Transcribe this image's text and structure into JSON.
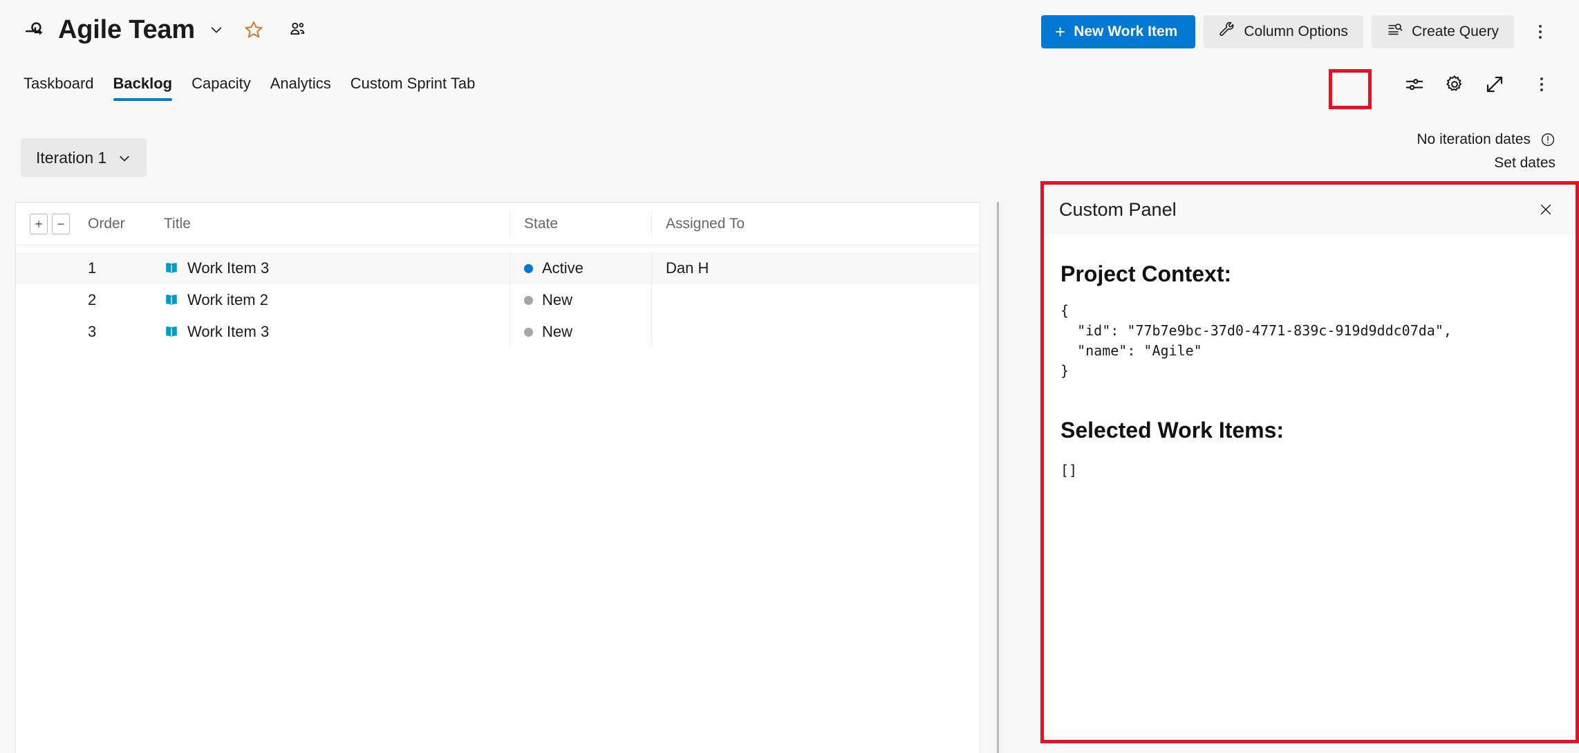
{
  "header": {
    "sprint_icon": "sprint-icon",
    "team_title": "Agile Team",
    "title_chevron_icon": "chevron-down-icon",
    "favorite_icon": "star-icon",
    "team_members_icon": "people-icon",
    "overflow_icon": "kebab-menu-icon"
  },
  "commandbar": {
    "new_work_item_label": "New Work Item",
    "new_work_item_plus": "+",
    "column_options_label": "Column Options",
    "column_options_icon": "wrench-icon",
    "create_query_label": "Create Query",
    "create_query_icon": "query-list-search-icon"
  },
  "tabs": [
    {
      "label": "Taskboard",
      "active": false
    },
    {
      "label": "Backlog",
      "active": true
    },
    {
      "label": "Capacity",
      "active": false
    },
    {
      "label": "Analytics",
      "active": false
    },
    {
      "label": "Custom Sprint Tab",
      "active": false
    }
  ],
  "tool_icons": [
    {
      "name": "view-options-sliders-icon",
      "highlighted": true
    },
    {
      "name": "gear-settings-icon",
      "highlighted": false
    },
    {
      "name": "full-screen-expand-icon",
      "highlighted": false
    },
    {
      "name": "kebab-menu-icon",
      "highlighted": false
    }
  ],
  "iteration": {
    "selected": "Iteration 1",
    "chevron_icon": "chevron-down-icon"
  },
  "iteration_dates": {
    "status": "No iteration dates",
    "info_icon": "warning-circle-icon",
    "action": "Set dates"
  },
  "grid": {
    "expand_all_label": "+",
    "collapse_all_label": "−",
    "columns": [
      "Order",
      "Title",
      "State",
      "Assigned To"
    ],
    "rows": [
      {
        "order": "1",
        "title": "Work Item 3",
        "type_icon": "user-story-book-icon",
        "state": "Active",
        "state_color": "#0078d4",
        "assigned_to": "Dan H",
        "selected": true
      },
      {
        "order": "2",
        "title": "Work item 2",
        "type_icon": "user-story-book-icon",
        "state": "New",
        "state_color": "#a6a6a6",
        "assigned_to": "",
        "selected": false
      },
      {
        "order": "3",
        "title": "Work Item 3",
        "type_icon": "user-story-book-icon",
        "state": "New",
        "state_color": "#a6a6a6",
        "assigned_to": "",
        "selected": false
      }
    ]
  },
  "panel": {
    "title": "Custom Panel",
    "close_icon": "close-icon",
    "project_context_heading": "Project Context:",
    "project_context_json": "{\n  \"id\": \"77b7e9bc-37d0-4771-839c-919d9ddc07da\",\n  \"name\": \"Agile\"\n}",
    "selected_work_items_heading": "Selected Work Items:",
    "selected_work_items_json": "[]"
  },
  "colors": {
    "accent": "#0078d4",
    "highlight_border": "#e81123",
    "page_background": "#f8f8f8",
    "button_secondary": "#eaeaea",
    "favorite_star": "#d8772a",
    "work_item_icon": "#009ccc"
  }
}
